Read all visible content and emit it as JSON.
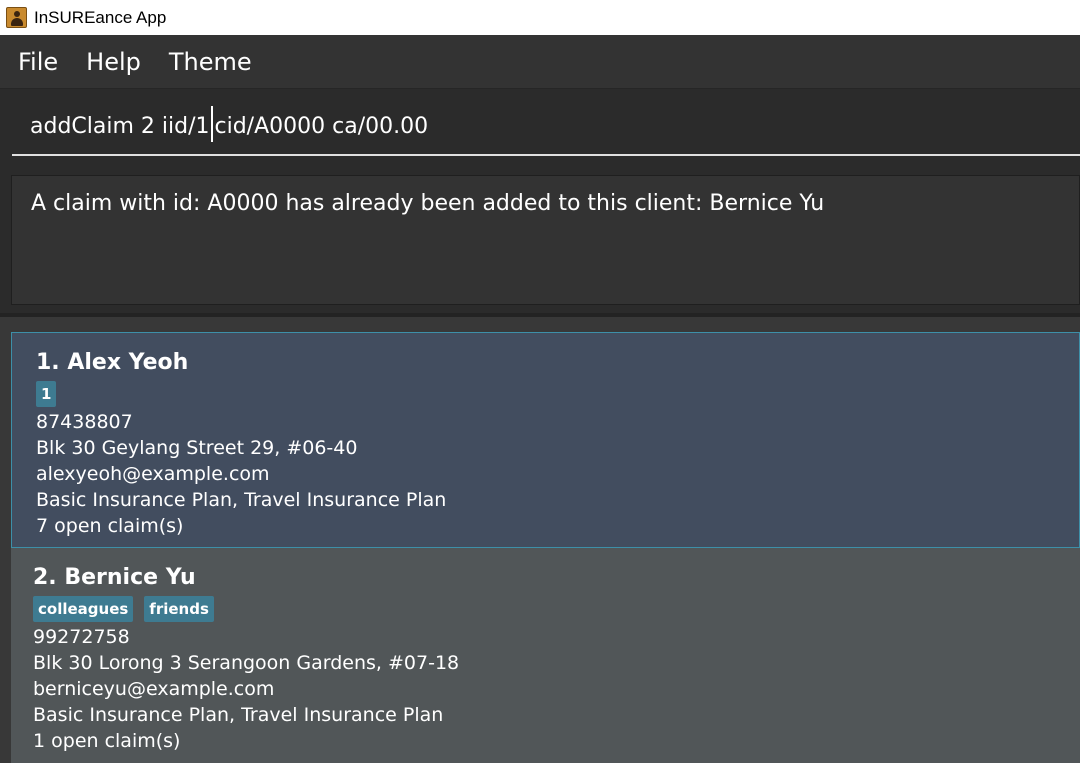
{
  "window": {
    "title": "InSUREance App"
  },
  "menu": {
    "items": [
      "File",
      "Help",
      "Theme"
    ]
  },
  "command": {
    "before_caret": "addClaim 2 iid/1",
    "after_caret": "cid/A0000 ca/00.00"
  },
  "result": {
    "message": "A claim with id: A0000 has already been added to this client: Bernice Yu"
  },
  "persons": [
    {
      "name": "1. Alex Yeoh",
      "tags": [
        "1"
      ],
      "phone": "87438807",
      "address": "Blk 30 Geylang Street 29, #06-40",
      "email": "alexyeoh@example.com",
      "plans": "Basic Insurance Plan, Travel Insurance Plan",
      "claims": "7 open claim(s)"
    },
    {
      "name": "2. Bernice Yu",
      "tags": [
        "colleagues",
        "friends"
      ],
      "phone": "99272758",
      "address": "Blk 30 Lorong 3 Serangoon Gardens, #07-18",
      "email": "berniceyu@example.com",
      "plans": "Basic Insurance Plan, Travel Insurance Plan",
      "claims": "1 open claim(s)"
    }
  ],
  "colors": {
    "selected_card": "#424d5f",
    "normal_card": "#515658",
    "tag": "#3e7b91",
    "selected_border": "#3d8fa8"
  }
}
